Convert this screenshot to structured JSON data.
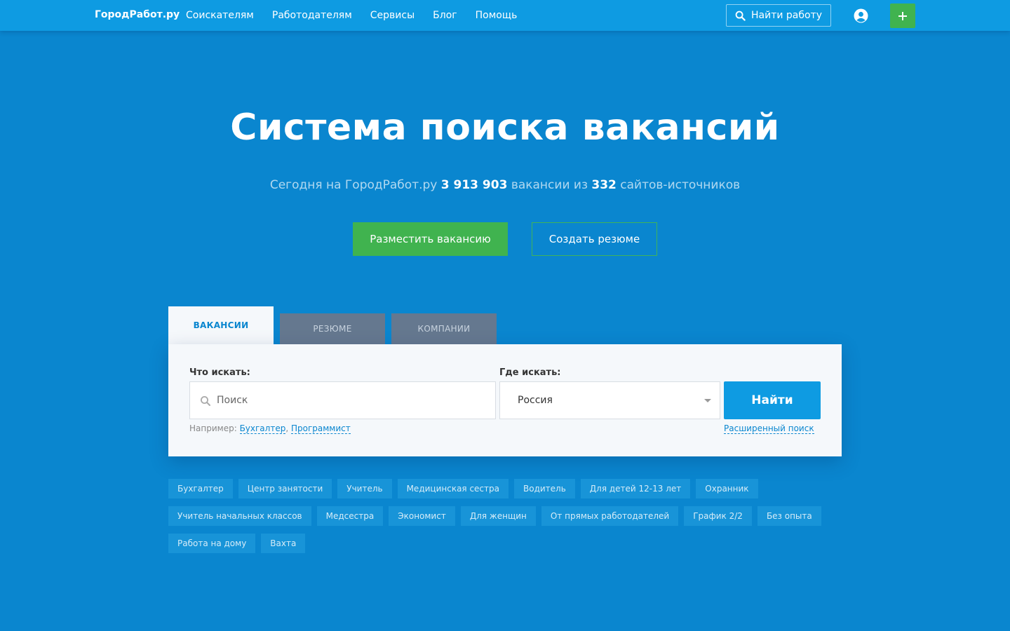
{
  "header": {
    "logo": "ГородРабот.ру",
    "nav": [
      "Соискателям",
      "Работодателям",
      "Сервисы",
      "Блог",
      "Помощь"
    ],
    "find_job_label": "Найти работу"
  },
  "hero": {
    "title": "Система поиска вакансий",
    "sub_prefix": "Сегодня на ГородРабот.ру",
    "vacancy_count": "3 913 903",
    "sub_middle": "вакансии из",
    "source_count": "332",
    "sub_suffix": "сайтов-источников",
    "post_vacancy_label": "Разместить вакансию",
    "create_resume_label": "Создать резюме"
  },
  "tabs": {
    "vacancies": "ВАКАНСИИ",
    "resume": "РЕЗЮМЕ",
    "companies": "КОМПАНИИ"
  },
  "search": {
    "what_label": "Что искать:",
    "what_placeholder": "Поиск",
    "where_label": "Где искать:",
    "where_value": "Россия",
    "find_label": "Найти",
    "example_prefix": "Например:",
    "example_1": "Бухгалтер",
    "example_2": "Программист",
    "advanced_label": "Расширенный поиск"
  },
  "tags": [
    [
      "Бухгалтер",
      "Центр занятости",
      "Учитель",
      "Медицинская сестра",
      "Водитель",
      "Для детей 12-13 лет",
      "Охранник"
    ],
    [
      "Учитель начальных классов",
      "Медсестра",
      "Экономист",
      "Для женщин",
      "От прямых работодателей",
      "График 2/2",
      "Без опыта"
    ],
    [
      "Работа на дому",
      "Вахта"
    ]
  ],
  "colors": {
    "background": "#0a86cf",
    "header": "#0e9be2",
    "accent_green": "#40b34f",
    "find_button": "#0e9be2"
  },
  "icons": {
    "find_job": "search-icon",
    "user": "user-circle-icon",
    "add": "plus-icon",
    "search_field": "search-icon",
    "select": "chevron-down-icon"
  }
}
